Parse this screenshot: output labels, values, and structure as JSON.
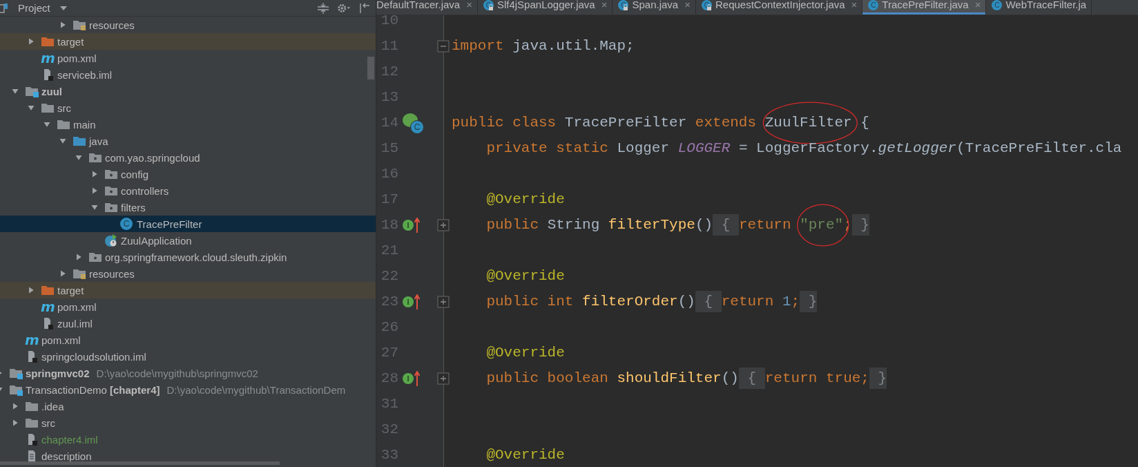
{
  "project_panel": {
    "title": "Project",
    "tree": [
      {
        "children": [
          {
            "children": [
              {
                "children": [
                  {
                    "children": [
                      {
                        "label": "resources",
                        "kind": "resources",
                        "expanded": false,
                        "selected": false
                      }
                    ]
                  }
                ]
              },
              {
                "label": "target",
                "kind": "excluded",
                "expanded": false,
                "selected": false
              },
              {
                "label": "pom.xml",
                "kind": "maven",
                "glyph": "m",
                "selected": false
              },
              {
                "label": "serviceb.iml",
                "kind": "iml",
                "selected": false
              }
            ]
          },
          {
            "label": "zuul",
            "kind": "module",
            "expanded": true,
            "selected": false,
            "children": [
              {
                "label": "src",
                "kind": "folder",
                "expanded": true,
                "selected": false,
                "children": [
                  {
                    "label": "main",
                    "kind": "folder",
                    "expanded": true,
                    "selected": false,
                    "children": [
                      {
                        "label": "java",
                        "kind": "source",
                        "expanded": true,
                        "selected": false,
                        "children": [
                          {
                            "label": "com.yao.springcloud",
                            "kind": "package",
                            "expanded": true,
                            "selected": false,
                            "children": [
                              {
                                "label": "config",
                                "kind": "package",
                                "expanded": false,
                                "selected": false
                              },
                              {
                                "label": "controllers",
                                "kind": "package",
                                "expanded": false,
                                "selected": false
                              },
                              {
                                "label": "filters",
                                "kind": "package",
                                "expanded": true,
                                "selected": false,
                                "children": [
                                  {
                                    "label": "TracePreFilter",
                                    "kind": "class",
                                    "glyph": "C",
                                    "selected": true
                                  }
                                ]
                              },
                              {
                                "label": "ZuulApplication",
                                "kind": "app",
                                "selected": false
                              }
                            ]
                          },
                          {
                            "label": "org.springframework.cloud.sleuth.zipkin",
                            "kind": "package",
                            "expanded": false,
                            "selected": false
                          }
                        ]
                      },
                      {
                        "label": "resources",
                        "kind": "resources",
                        "expanded": false,
                        "selected": false
                      }
                    ]
                  }
                ]
              },
              {
                "label": "target",
                "kind": "excluded",
                "expanded": false,
                "selected": false
              },
              {
                "label": "pom.xml",
                "kind": "maven",
                "glyph": "m",
                "selected": false
              },
              {
                "label": "zuul.iml",
                "kind": "iml",
                "selected": false
              }
            ]
          },
          {
            "label": "pom.xml",
            "kind": "maven",
            "glyph": "m",
            "selected": false
          },
          {
            "label": "springcloudsolution.iml",
            "kind": "iml",
            "selected": false
          }
        ]
      },
      {
        "label": "springmvc02",
        "kind": "module",
        "path": "D:\\yao\\code\\mygithub\\springmvc02",
        "expanded": false,
        "selected": false
      },
      {
        "label": "TransactionDemo **[chapter4]**",
        "kind": "module-plain",
        "path": "D:\\yao\\code\\mygithub\\TransactionDem",
        "expanded": true,
        "selected": false,
        "children": [
          {
            "label": ".idea",
            "kind": "folder",
            "expanded": false,
            "selected": false
          },
          {
            "label": "src",
            "kind": "folder",
            "expanded": false,
            "selected": false
          },
          {
            "label": "chapter4.iml",
            "kind": "iml",
            "color": "#629755",
            "selected": false
          },
          {
            "label": "description",
            "kind": "text",
            "selected": false
          }
        ]
      }
    ]
  },
  "editor": {
    "tabs": [
      {
        "label": "DefaultTracer.java",
        "close": "×",
        "selected": false
      },
      {
        "label": "Slf4jSpanLogger.java",
        "glyph": "C",
        "locked": true,
        "close": "×",
        "selected": false
      },
      {
        "label": "Span.java",
        "glyph": "C",
        "locked": true,
        "close": "×",
        "selected": false
      },
      {
        "label": "RequestContextInjector.java",
        "glyph": "C",
        "locked": true,
        "close": "×",
        "selected": false
      },
      {
        "label": "TracePreFilter.java",
        "glyph": "C",
        "locked": false,
        "close": "×",
        "selected": true
      },
      {
        "label": "WebTraceFilter.ja",
        "glyph": "C",
        "locked": false,
        "selected": false
      }
    ],
    "lines": [
      {
        "number": "10"
      },
      {
        "number": "11",
        "fold": {
          "kind": "collapse"
        },
        "tokens": [
          {
            "text": "import",
            "kind": "keyword",
            "circled": false
          },
          {
            "text": " java.util.Map;",
            "kind": "plain",
            "circled": false
          }
        ]
      },
      {
        "number": "12"
      },
      {
        "number": "13"
      },
      {
        "number": "14",
        "gutter": {
          "kind": "class",
          "glyph": "C"
        },
        "tokens": [
          {
            "text": "public class ",
            "kind": "keyword",
            "circled": false
          },
          {
            "text": "TracePreFilter ",
            "kind": "plain",
            "circled": false
          },
          {
            "text": "extends ",
            "kind": "keyword",
            "circled": false
          },
          {
            "text": "ZuulFilter",
            "kind": "plain",
            "circled": true
          },
          {
            "text": " {",
            "kind": "plain",
            "circled": false
          }
        ]
      },
      {
        "number": "15",
        "tokens": [
          {
            "text": "    private static ",
            "kind": "keyword",
            "circled": false
          },
          {
            "text": "Logger ",
            "kind": "plain",
            "circled": false
          },
          {
            "text": "LOGGER",
            "kind": "field",
            "circled": false
          },
          {
            "text": " = LoggerFactory.",
            "kind": "plain",
            "circled": false
          },
          {
            "text": "getLogger",
            "kind": "static-call",
            "circled": false
          },
          {
            "text": "(TracePreFilter.cla",
            "kind": "plain",
            "circled": false
          }
        ]
      },
      {
        "number": "16"
      },
      {
        "number": "17",
        "tokens": [
          {
            "text": "    @Override",
            "kind": "annotation",
            "circled": false
          }
        ]
      },
      {
        "number": "18",
        "gutter": {
          "kind": "implements",
          "glyph": "I"
        },
        "fold": {
          "kind": "expand"
        },
        "tokens": [
          {
            "text": "    public ",
            "kind": "keyword",
            "circled": false
          },
          {
            "text": "String ",
            "kind": "plain",
            "circled": false
          },
          {
            "text": "filterType",
            "kind": "method",
            "circled": false
          },
          {
            "text": "()",
            "kind": "plain",
            "circled": false
          },
          {
            "text": " { ",
            "kind": "fold",
            "circled": false
          },
          {
            "text": "return ",
            "kind": "keyword",
            "circled": false
          },
          {
            "text": "\"pre\"",
            "kind": "string",
            "circled": true
          },
          {
            "text": ";",
            "kind": "keyword",
            "circled": false
          },
          {
            "text": " }",
            "kind": "fold",
            "circled": false
          }
        ]
      },
      {
        "number": "21"
      },
      {
        "number": "22",
        "tokens": [
          {
            "text": "    @Override",
            "kind": "annotation",
            "circled": false
          }
        ]
      },
      {
        "number": "23",
        "gutter": {
          "kind": "implements",
          "glyph": "I"
        },
        "fold": {
          "kind": "expand"
        },
        "tokens": [
          {
            "text": "    public int ",
            "kind": "keyword",
            "circled": false
          },
          {
            "text": "filterOrder",
            "kind": "method",
            "circled": false
          },
          {
            "text": "()",
            "kind": "plain",
            "circled": false
          },
          {
            "text": " { ",
            "kind": "fold",
            "circled": false
          },
          {
            "text": "return ",
            "kind": "keyword",
            "circled": false
          },
          {
            "text": "1",
            "kind": "number",
            "circled": false
          },
          {
            "text": ";",
            "kind": "keyword",
            "circled": false
          },
          {
            "text": " }",
            "kind": "fold",
            "circled": false
          }
        ]
      },
      {
        "number": "26"
      },
      {
        "number": "27",
        "tokens": [
          {
            "text": "    @Override",
            "kind": "annotation",
            "circled": false
          }
        ]
      },
      {
        "number": "28",
        "gutter": {
          "kind": "implements",
          "glyph": "I"
        },
        "fold": {
          "kind": "expand"
        },
        "tokens": [
          {
            "text": "    public boolean ",
            "kind": "keyword",
            "circled": false
          },
          {
            "text": "shouldFilter",
            "kind": "method",
            "circled": false
          },
          {
            "text": "()",
            "kind": "plain",
            "circled": false
          },
          {
            "text": " { ",
            "kind": "fold",
            "circled": false
          },
          {
            "text": "return true;",
            "kind": "keyword",
            "circled": false
          },
          {
            "text": " }",
            "kind": "fold",
            "circled": false
          }
        ]
      },
      {
        "number": "31"
      },
      {
        "number": "32"
      },
      {
        "number": "33",
        "tokens": [
          {
            "text": "    @Override",
            "kind": "annotation",
            "circled": false
          }
        ]
      }
    ]
  }
}
